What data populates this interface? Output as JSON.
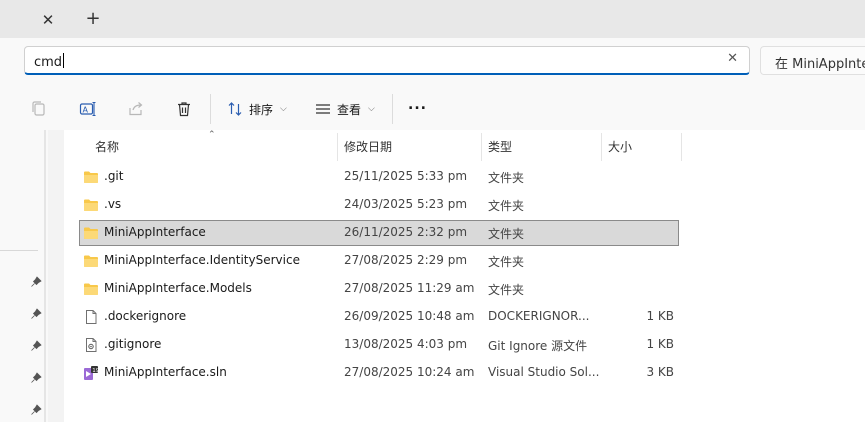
{
  "tabs": {
    "close_icon": "close-icon",
    "new_tab_icon": "plus-icon"
  },
  "address": {
    "value": "cmd",
    "clear_icon": "close-icon"
  },
  "search": {
    "placeholder": "在 MiniAppInte"
  },
  "toolbar": {
    "copy_icon": "copy-icon",
    "rename_icon": "rename-icon",
    "share_icon": "share-icon",
    "delete_icon": "delete-icon",
    "sort_label": "排序",
    "view_label": "查看",
    "more_label": "..."
  },
  "columns": {
    "name": "名称",
    "date": "修改日期",
    "type": "类型",
    "size": "大小"
  },
  "files": [
    {
      "name": ".git",
      "date": "25/11/2025 5:33 pm",
      "type": "文件夹",
      "size": "",
      "icon": "folder-icon"
    },
    {
      "name": ".vs",
      "date": "24/03/2025 5:23 pm",
      "type": "文件夹",
      "size": "",
      "icon": "folder-icon"
    },
    {
      "name": "MiniAppInterface",
      "date": "26/11/2025 2:32 pm",
      "type": "文件夹",
      "size": "",
      "icon": "folder-icon",
      "selected": true
    },
    {
      "name": "MiniAppInterface.IdentityService",
      "date": "27/08/2025 2:29 pm",
      "type": "文件夹",
      "size": "",
      "icon": "folder-icon"
    },
    {
      "name": "MiniAppInterface.Models",
      "date": "27/08/2025 11:29 am",
      "type": "文件夹",
      "size": "",
      "icon": "folder-icon"
    },
    {
      "name": ".dockerignore",
      "date": "26/09/2025 10:48 am",
      "type": "DOCKERIGNOR...",
      "size": "1 KB",
      "icon": "file-icon"
    },
    {
      "name": ".gitignore",
      "date": "13/08/2025 4:03 pm",
      "type": "Git Ignore 源文件",
      "size": "1 KB",
      "icon": "gitignore-file-icon"
    },
    {
      "name": "MiniAppInterface.sln",
      "date": "27/08/2025 10:24 am",
      "type": "Visual Studio Sol...",
      "size": "3 KB",
      "icon": "visual-studio-solution-icon"
    }
  ],
  "colors": {
    "accent": "#005fb8",
    "folder": "#f8c84a",
    "selected_row": "#d9d9d9"
  }
}
